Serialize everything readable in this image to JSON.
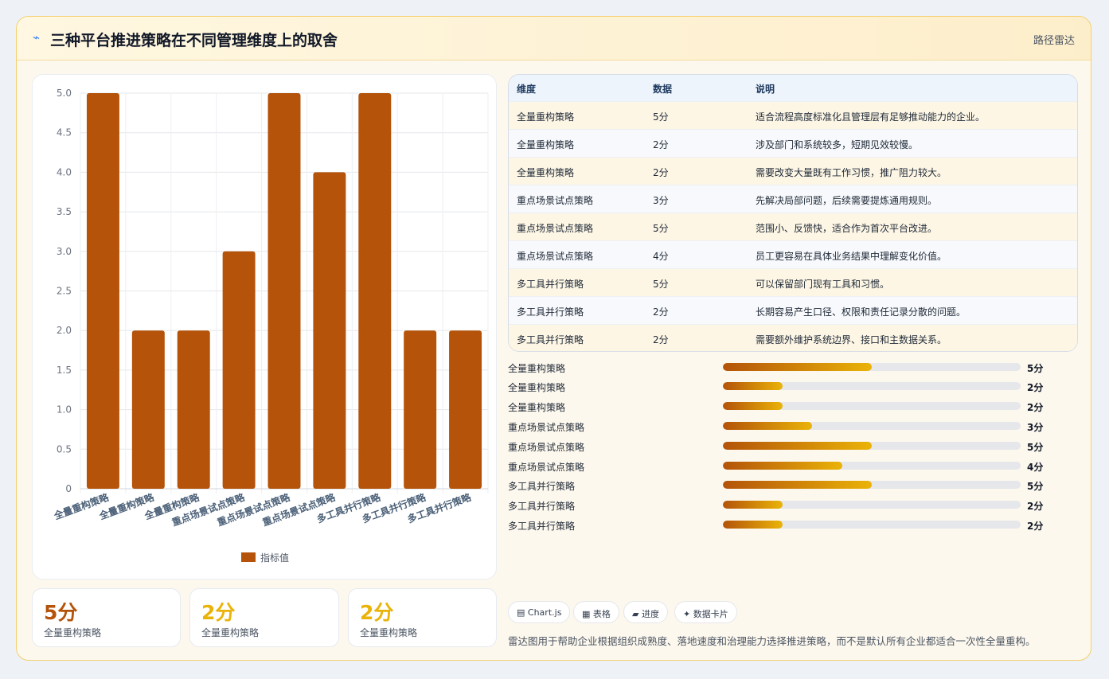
{
  "header": {
    "title": "三种平台推进策略在不同管理维度上的取舍",
    "tag": "路径雷达",
    "icon": "bolt-icon"
  },
  "chart_data": {
    "type": "bar",
    "categories": [
      "全量重构策略",
      "全量重构策略",
      "全量重构策略",
      "重点场景试点策略",
      "重点场景试点策略",
      "重点场景试点策略",
      "多工具并行策略",
      "多工具并行策略",
      "多工具并行策略"
    ],
    "series": [
      {
        "name": "指标值",
        "values": [
          5,
          2,
          2,
          3,
          5,
          4,
          5,
          2,
          2
        ],
        "color": "#b45309"
      }
    ],
    "ylim": [
      0,
      5
    ],
    "yticks": [
      "0",
      "0.5",
      "1.0",
      "1.5",
      "2.0",
      "2.5",
      "3.0",
      "3.5",
      "4.0",
      "4.5",
      "5.0"
    ],
    "legend": "bottom",
    "grid": true
  },
  "kpis": [
    {
      "value": "5分",
      "label": "全量重构策略",
      "color": "#b45309"
    },
    {
      "value": "2分",
      "label": "全量重构策略",
      "color": "#eab308"
    },
    {
      "value": "2分",
      "label": "全量重构策略",
      "color": "#eab308"
    }
  ],
  "table": {
    "headers": [
      "维度",
      "数据",
      "说明"
    ],
    "rows": [
      [
        "全量重构策略",
        "5分",
        "适合流程高度标准化且管理层有足够推动能力的企业。"
      ],
      [
        "全量重构策略",
        "2分",
        "涉及部门和系统较多，短期见效较慢。"
      ],
      [
        "全量重构策略",
        "2分",
        "需要改变大量既有工作习惯，推广阻力较大。"
      ],
      [
        "重点场景试点策略",
        "3分",
        "先解决局部问题，后续需要提炼通用规则。"
      ],
      [
        "重点场景试点策略",
        "5分",
        "范围小、反馈快，适合作为首次平台改进。"
      ],
      [
        "重点场景试点策略",
        "4分",
        "员工更容易在具体业务结果中理解变化价值。"
      ],
      [
        "多工具并行策略",
        "5分",
        "可以保留部门现有工具和习惯。"
      ],
      [
        "多工具并行策略",
        "2分",
        "长期容易产生口径、权限和责任记录分散的问题。"
      ],
      [
        "多工具并行策略",
        "2分",
        "需要额外维护系统边界、接口和主数据关系。"
      ]
    ]
  },
  "progress": [
    {
      "label": "全量重构策略",
      "value": 5,
      "max": 10,
      "text": "5分"
    },
    {
      "label": "全量重构策略",
      "value": 2,
      "max": 10,
      "text": "2分"
    },
    {
      "label": "全量重构策略",
      "value": 2,
      "max": 10,
      "text": "2分"
    },
    {
      "label": "重点场景试点策略",
      "value": 3,
      "max": 10,
      "text": "3分"
    },
    {
      "label": "重点场景试点策略",
      "value": 5,
      "max": 10,
      "text": "5分"
    },
    {
      "label": "重点场景试点策略",
      "value": 4,
      "max": 10,
      "text": "4分"
    },
    {
      "label": "多工具并行策略",
      "value": 5,
      "max": 10,
      "text": "5分"
    },
    {
      "label": "多工具并行策略",
      "value": 2,
      "max": 10,
      "text": "2分"
    },
    {
      "label": "多工具并行策略",
      "value": 2,
      "max": 10,
      "text": "2分"
    }
  ],
  "chips": [
    {
      "icon": "chart-icon",
      "glyph": "▤",
      "label": "Chart.js"
    },
    {
      "icon": "table-icon",
      "glyph": "▦",
      "label": "表格"
    },
    {
      "icon": "progress-icon",
      "glyph": "▰",
      "label": "进度"
    },
    {
      "icon": "sparkle-icon",
      "glyph": "✦",
      "label": "数据卡片"
    }
  ],
  "note": "雷达图用于帮助企业根据组织成熟度、落地速度和治理能力选择推进策略，而不是默认所有企业都适合一次性全量重构。"
}
